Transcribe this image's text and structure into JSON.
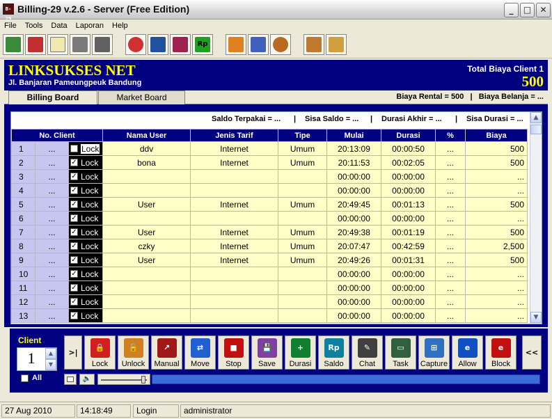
{
  "window": {
    "title": "Billing-29 v.2.6 - Server (Free Edition)",
    "icon_label": "B-29",
    "controls": [
      "_",
      "□",
      "✕"
    ]
  },
  "menu": [
    "File",
    "Tools",
    "Data",
    "Laporan",
    "Help"
  ],
  "toolbar": {
    "icons": [
      "network-map-icon",
      "key-icon",
      "notepad-icon",
      "eraser-icon",
      "close-x-icon",
      "no-icon",
      "calc-icon",
      "stats-icon",
      "rupiah-icon",
      "members-m-icon",
      "members-o-icon",
      "food-icon",
      "home-icon",
      "home-rp-icon"
    ],
    "rp_label": "Rp"
  },
  "header": {
    "company": "LINKSUKSES NET",
    "address": "Jl. Banjaran Pameungpeuk Bandung",
    "total_label": "Total Biaya Client 1",
    "total_value": "500"
  },
  "tabs": {
    "billing": "Billing Board",
    "market": "Market Board",
    "rental": "Biaya Rental = 500",
    "divider": "|",
    "belanja": "Biaya Belanja = ..."
  },
  "summary": {
    "saldo_terpakai": "Saldo Terpakai = ...",
    "sisa_saldo": "Sisa Saldo = ...",
    "durasi_akhir": "Durasi Akhir = ...",
    "sisa_durasi": "Sisa Durasi = ...",
    "divider": "|"
  },
  "table": {
    "headers": [
      "No. Client",
      "Nama User",
      "Jenis Tarif",
      "Tipe",
      "Mulai",
      "Durasi",
      "%",
      "Biaya"
    ],
    "lock_label": "Lock",
    "rows": [
      {
        "no": "1",
        "dots": "...",
        "checked": false,
        "user": "ddv",
        "tarif": "Internet",
        "tipe": "Umum",
        "mulai": "20:13:09",
        "durasi": "00:00:50",
        "pct": "...",
        "biaya": "500"
      },
      {
        "no": "2",
        "dots": "...",
        "checked": true,
        "user": "bona",
        "tarif": "Internet",
        "tipe": "Umum",
        "mulai": "20:11:53",
        "durasi": "00:02:05",
        "pct": "...",
        "biaya": "500"
      },
      {
        "no": "3",
        "dots": "...",
        "checked": true,
        "user": "",
        "tarif": "",
        "tipe": "",
        "mulai": "00:00:00",
        "durasi": "00:00:00",
        "pct": "...",
        "biaya": "..."
      },
      {
        "no": "4",
        "dots": "...",
        "checked": true,
        "user": "",
        "tarif": "",
        "tipe": "",
        "mulai": "00:00:00",
        "durasi": "00:00:00",
        "pct": "...",
        "biaya": "..."
      },
      {
        "no": "5",
        "dots": "...",
        "checked": true,
        "user": "User",
        "tarif": "Internet",
        "tipe": "Umum",
        "mulai": "20:49:45",
        "durasi": "00:01:13",
        "pct": "...",
        "biaya": "500"
      },
      {
        "no": "6",
        "dots": "...",
        "checked": true,
        "user": "",
        "tarif": "",
        "tipe": "",
        "mulai": "00:00:00",
        "durasi": "00:00:00",
        "pct": "...",
        "biaya": "..."
      },
      {
        "no": "7",
        "dots": "...",
        "checked": true,
        "user": "User",
        "tarif": "Internet",
        "tipe": "Umum",
        "mulai": "20:49:38",
        "durasi": "00:01:19",
        "pct": "...",
        "biaya": "500"
      },
      {
        "no": "8",
        "dots": "...",
        "checked": true,
        "user": "czky",
        "tarif": "Internet",
        "tipe": "Umum",
        "mulai": "20:07:47",
        "durasi": "00:42:59",
        "pct": "...",
        "biaya": "2,500"
      },
      {
        "no": "9",
        "dots": "...",
        "checked": true,
        "user": "User",
        "tarif": "Internet",
        "tipe": "Umum",
        "mulai": "20:49:26",
        "durasi": "00:01:31",
        "pct": "...",
        "biaya": "500"
      },
      {
        "no": "10",
        "dots": "...",
        "checked": true,
        "user": "",
        "tarif": "",
        "tipe": "",
        "mulai": "00:00:00",
        "durasi": "00:00:00",
        "pct": "...",
        "biaya": "..."
      },
      {
        "no": "11",
        "dots": "...",
        "checked": true,
        "user": "",
        "tarif": "",
        "tipe": "",
        "mulai": "00:00:00",
        "durasi": "00:00:00",
        "pct": "...",
        "biaya": "..."
      },
      {
        "no": "12",
        "dots": "...",
        "checked": true,
        "user": "",
        "tarif": "",
        "tipe": "",
        "mulai": "00:00:00",
        "durasi": "00:00:00",
        "pct": "...",
        "biaya": "..."
      },
      {
        "no": "13",
        "dots": "...",
        "checked": true,
        "user": "",
        "tarif": "",
        "tipe": "",
        "mulai": "00:00:00",
        "durasi": "00:00:00",
        "pct": "...",
        "biaya": "..."
      }
    ]
  },
  "controls": {
    "client_label": "Client",
    "client_value": "1",
    "all_label": "All",
    "first_label": ">|",
    "last_label": "<<",
    "speaker_glyph": "🔈",
    "actions": [
      {
        "label": "Lock",
        "icon": "lock-icon",
        "color": "#d02020",
        "glyph": "🔒"
      },
      {
        "label": "Unlock",
        "icon": "unlock-icon",
        "color": "#d08020",
        "glyph": "🔓"
      },
      {
        "label": "Manual",
        "icon": "manual-icon",
        "color": "#a01818",
        "glyph": "↗"
      },
      {
        "label": "Move",
        "icon": "move-icon",
        "color": "#2060d0",
        "glyph": "⇄"
      },
      {
        "label": "Stop",
        "icon": "stop-icon",
        "color": "#c01010",
        "glyph": "■"
      },
      {
        "label": "Save",
        "icon": "save-icon",
        "color": "#8040a0",
        "glyph": "💾"
      },
      {
        "label": "Durasi",
        "icon": "durasi-icon",
        "color": "#108030",
        "glyph": "+"
      },
      {
        "label": "Saldo",
        "icon": "saldo-icon",
        "color": "#1080a0",
        "glyph": "Rp"
      },
      {
        "label": "Chat",
        "icon": "chat-icon",
        "color": "#404040",
        "glyph": "✎"
      },
      {
        "label": "Task",
        "icon": "task-icon",
        "color": "#306040",
        "glyph": "▭"
      },
      {
        "label": "Capture",
        "icon": "capture-icon",
        "color": "#3070c0",
        "glyph": "⊞"
      },
      {
        "label": "Allow",
        "icon": "allow-icon",
        "color": "#1050c0",
        "glyph": "e"
      },
      {
        "label": "Block",
        "icon": "block-icon",
        "color": "#c01010",
        "glyph": "e"
      }
    ]
  },
  "statusbar": {
    "date": "27 Aug 2010",
    "time": "14:18:49",
    "mode": "Login",
    "user": "administrator"
  }
}
